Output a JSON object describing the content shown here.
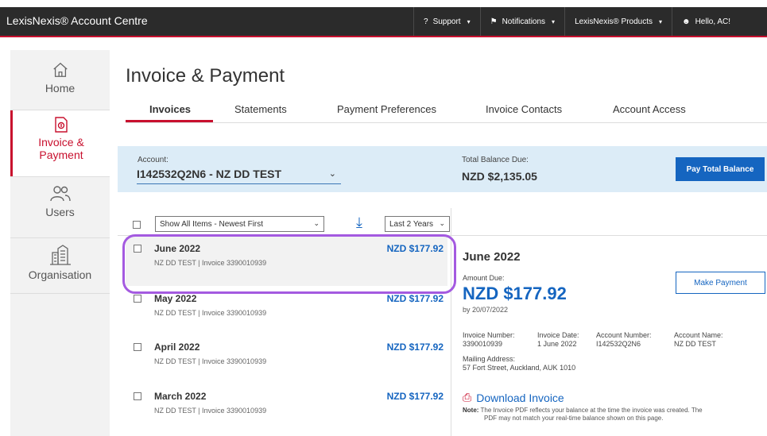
{
  "header": {
    "brand": "LexisNexis® Account Centre",
    "nav": [
      {
        "icon": "question-circle-icon",
        "label": "Support"
      },
      {
        "icon": "flag-icon",
        "label": "Notifications"
      },
      {
        "icon": "",
        "label": "LexisNexis® Products"
      },
      {
        "icon": "user-icon",
        "label": "Hello, AC!"
      }
    ],
    "caret": "▾",
    "support_glyph": "?",
    "flag_glyph": "⚑",
    "user_glyph": "☻"
  },
  "sidebar": {
    "items": [
      {
        "icon": "home-icon",
        "label": "Home"
      },
      {
        "icon": "invoice-icon",
        "label1": "Invoice &",
        "label2": "Payment"
      },
      {
        "icon": "users-icon",
        "label": "Users"
      },
      {
        "icon": "building-icon",
        "label": "Organisation"
      }
    ]
  },
  "page": {
    "title": "Invoice & Payment",
    "tabs": [
      "Invoices",
      "Statements",
      "Payment Preferences",
      "Invoice Contacts",
      "Account Access"
    ]
  },
  "account": {
    "label": "Account:",
    "value": "I142532Q2N6 - NZ DD TEST",
    "balance_label": "Total Balance Due:",
    "balance_value": "NZD $2,135.05",
    "pay_total": "Pay Total Balance"
  },
  "filters": {
    "sort": "Show All Items - Newest First",
    "range": "Last 2 Years",
    "sort_glyph": "⤓"
  },
  "invoices": [
    {
      "month": "June 2022",
      "sub": "NZ DD TEST | Invoice 3390010939",
      "amount": "NZD $177.92"
    },
    {
      "month": "May 2022",
      "sub": "NZ DD TEST | Invoice 3390010939",
      "amount": "NZD $177.92"
    },
    {
      "month": "April 2022",
      "sub": "NZ DD TEST | Invoice 3390010939",
      "amount": "NZD $177.92"
    },
    {
      "month": "March 2022",
      "sub": "NZ DD TEST | Invoice 3390010939",
      "amount": "NZD $177.92"
    }
  ],
  "detail": {
    "month": "June 2022",
    "amount_label": "Amount Due:",
    "amount": "NZD $177.92",
    "due": "by 20/07/2022",
    "make_payment": "Make Payment",
    "meta": [
      {
        "k": "Invoice Number:",
        "v": "3390010939"
      },
      {
        "k": "Invoice Date:",
        "v": "1 June 2022"
      },
      {
        "k": "Account Number:",
        "v": "I142532Q2N6"
      },
      {
        "k": "Account Name:",
        "v": "NZ DD TEST"
      }
    ],
    "address_label": "Mailing Address:",
    "address": "57 Fort Street, Auckland, AUK 1010",
    "download": "Download Invoice",
    "pdf_glyph": "⎙",
    "note_label": "Note:",
    "note_line1": "The Invoice PDF reflects your balance at the time the invoice was created. The",
    "note_line2": "PDF may not match your real-time balance shown on this page."
  },
  "colors": {
    "brand_red": "#c8102e",
    "accent_blue": "#1565c0",
    "highlight_purple": "#a45ae0"
  }
}
